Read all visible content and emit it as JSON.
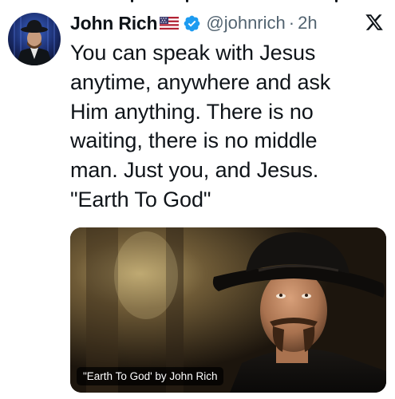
{
  "tweet": {
    "author_name": "John Rich",
    "handle": "@johnrich",
    "separator": "·",
    "time": "2h",
    "text": "You can speak with Jesus\nanytime, anywhere and ask\nHim anything. There is no\nwaiting, there is no middle\nman. Just you, and Jesus.\n\"Earth To God\"",
    "media": {
      "caption": "\"Earth To God' by John Rich"
    }
  },
  "icons": {
    "flag": "us-flag-icon",
    "verified": "verified-badge-icon",
    "brand": "x-logo-icon"
  },
  "colors": {
    "text": "#0f1419",
    "secondary": "#536471",
    "verified": "#1d9bf0"
  }
}
